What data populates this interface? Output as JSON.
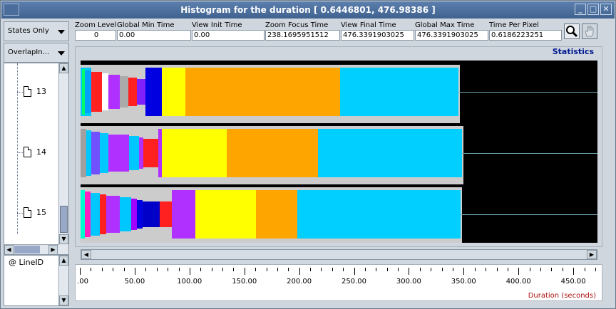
{
  "window": {
    "title": "Histogram for the duration [ 0.6446801, 476.98386 ]",
    "buttons": [
      "minimize-icon",
      "maximize-icon",
      "close-icon"
    ]
  },
  "left_panel": {
    "states_combo": "States Only",
    "overlap_combo": "OverlapIn...",
    "tree_items": [
      "13",
      "14",
      "15"
    ],
    "line_id": "@ LineID"
  },
  "toolbar": {
    "zoom_level": {
      "label": "Zoom Level",
      "value": "0"
    },
    "global_min_time": {
      "label": "Global Min Time",
      "value": "0.00"
    },
    "view_init_time": {
      "label": "View  Init Time",
      "value": "0.00"
    },
    "zoom_focus_time": {
      "label": "Zoom Focus Time",
      "value": "238.1695951512"
    },
    "view_final_time": {
      "label": "View Final Time",
      "value": "476.3391903025"
    },
    "global_max_time": {
      "label": "Global Max Time",
      "value": "476.3391903025"
    },
    "time_per_pixel": {
      "label": "Time Per Pixel",
      "value": "0.6186223251"
    },
    "tools": [
      "magnifier-icon",
      "hand-icon"
    ]
  },
  "chart": {
    "section_label": "Statistics",
    "axis_unit": "Duration (seconds)",
    "tick_labels": [
      ".00",
      "50.00",
      "100.00",
      "150.00",
      "200.00",
      "250.00",
      "300.00",
      "350.00",
      "400.00",
      "450.00"
    ]
  },
  "chart_data": {
    "type": "bar",
    "xlabel": "Duration (seconds)",
    "xlim": [
      0,
      476.34
    ],
    "rows": [
      {
        "label": "13",
        "segments": [
          {
            "start": 0,
            "end": 10,
            "color": "#00c8ff"
          },
          {
            "start": 1,
            "end": 4,
            "color": "#00ff66"
          },
          {
            "start": 4,
            "end": 10,
            "color": "#00a0ff"
          },
          {
            "start": 10,
            "end": 20,
            "color": "#ff2020"
          },
          {
            "start": 20,
            "end": 26,
            "color": "#ffffff"
          },
          {
            "start": 26,
            "end": 36,
            "color": "#b030ff"
          },
          {
            "start": 36,
            "end": 44,
            "color": "#aaaaaa"
          },
          {
            "start": 44,
            "end": 52,
            "color": "#ff2020"
          },
          {
            "start": 52,
            "end": 60,
            "color": "#8020ff"
          },
          {
            "start": 60,
            "end": 75,
            "color": "#0000e0"
          },
          {
            "start": 75,
            "end": 97,
            "color": "#ffff00"
          },
          {
            "start": 97,
            "end": 240,
            "color": "#ffa500"
          },
          {
            "start": 240,
            "end": 349,
            "color": "#00cfff"
          }
        ]
      },
      {
        "label": "14",
        "segments": [
          {
            "start": 0,
            "end": 5,
            "color": "#a0a0a0"
          },
          {
            "start": 5,
            "end": 10,
            "color": "#00c8ff"
          },
          {
            "start": 10,
            "end": 18,
            "color": "#7050ff"
          },
          {
            "start": 18,
            "end": 26,
            "color": "#00c8ff"
          },
          {
            "start": 26,
            "end": 45,
            "color": "#b030ff"
          },
          {
            "start": 45,
            "end": 54,
            "color": "#00c8ff"
          },
          {
            "start": 54,
            "end": 58,
            "color": "#b030ff"
          },
          {
            "start": 58,
            "end": 72,
            "color": "#ff2020"
          },
          {
            "start": 72,
            "end": 75,
            "color": "#b030ff"
          },
          {
            "start": 75,
            "end": 135,
            "color": "#ffff00"
          },
          {
            "start": 135,
            "end": 219,
            "color": "#ffa500"
          },
          {
            "start": 219,
            "end": 352,
            "color": "#00cfff"
          }
        ]
      },
      {
        "label": "15",
        "segments": [
          {
            "start": 0,
            "end": 4,
            "color": "#00ffcc"
          },
          {
            "start": 4,
            "end": 9,
            "color": "#ff20c0"
          },
          {
            "start": 9,
            "end": 18,
            "color": "#00c8ff"
          },
          {
            "start": 18,
            "end": 24,
            "color": "#ff2020"
          },
          {
            "start": 24,
            "end": 36,
            "color": "#b030ff"
          },
          {
            "start": 36,
            "end": 47,
            "color": "#00c8ff"
          },
          {
            "start": 47,
            "end": 52,
            "color": "#a000ff"
          },
          {
            "start": 52,
            "end": 57,
            "color": "#0000e0"
          },
          {
            "start": 57,
            "end": 73,
            "color": "#0000c8"
          },
          {
            "start": 73,
            "end": 84,
            "color": "#ff2020"
          },
          {
            "start": 84,
            "end": 106,
            "color": "#b030ff"
          },
          {
            "start": 106,
            "end": 162,
            "color": "#ffff00"
          },
          {
            "start": 162,
            "end": 200,
            "color": "#ffa500"
          },
          {
            "start": 200,
            "end": 351,
            "color": "#00cfff"
          }
        ]
      }
    ]
  }
}
